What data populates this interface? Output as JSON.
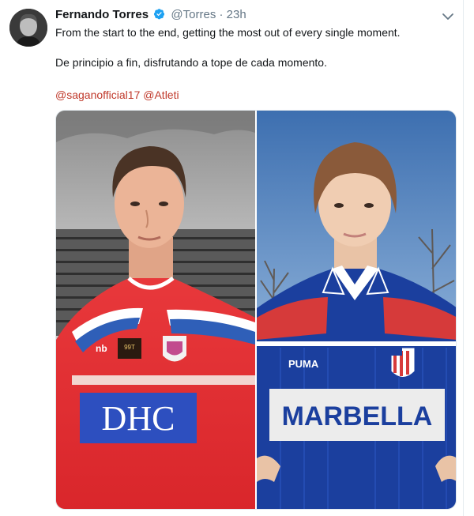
{
  "tweet": {
    "author_name": "Fernando Torres",
    "handle": "@Torres",
    "separator": "·",
    "time": "23h",
    "text_en": "From the start to the end, getting the most out of every single moment.",
    "text_es": "De principio a fin, disfrutando a tope de cada momento.",
    "mentions": [
      "@saganofficial17",
      "@Atleti"
    ]
  },
  "photos": {
    "left_shirt_sponsor": "DHC",
    "left_shirt_badge": "99T",
    "right_shirt_sponsor": "MARBELLA",
    "right_shirt_brand": "PUMA"
  },
  "icons": {
    "verified": "verified-badge-icon",
    "caret": "chevron-down-icon"
  },
  "colors": {
    "verified": "#1da1f2",
    "mention": "#c0392b",
    "muted": "#657786"
  }
}
